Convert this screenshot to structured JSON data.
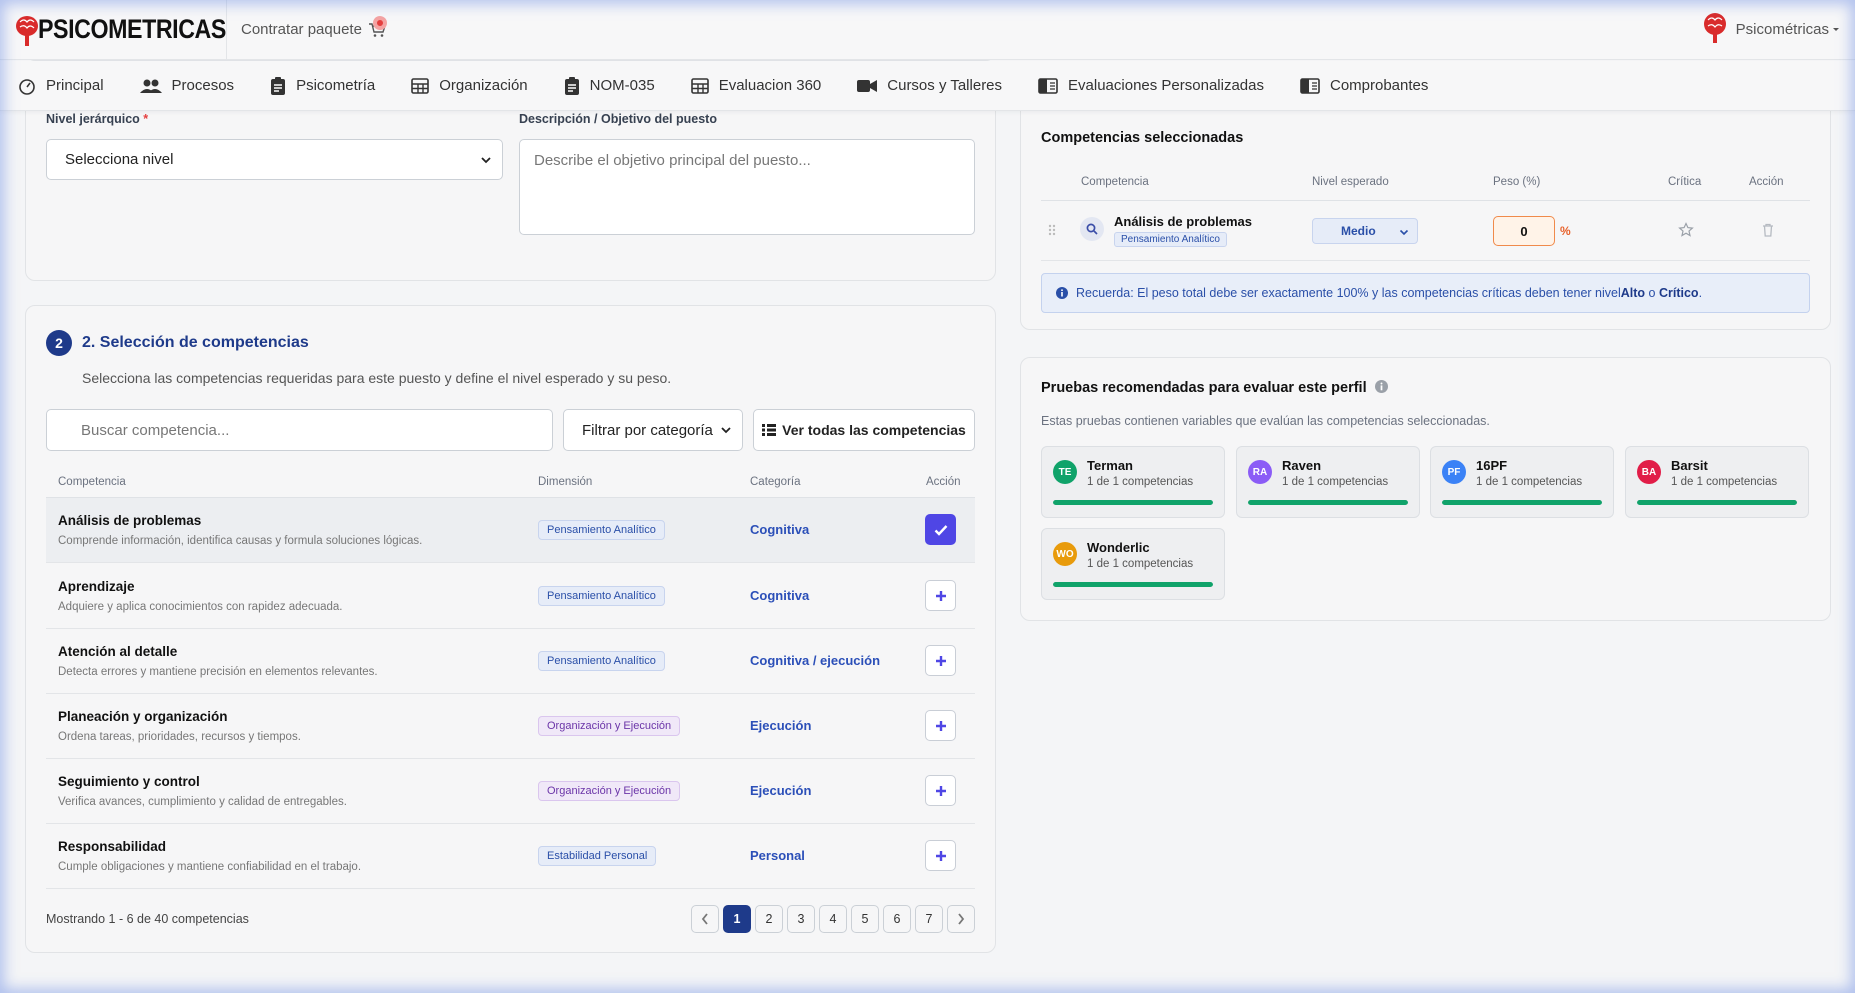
{
  "header": {
    "logo_text": "PSICOMETRICAS",
    "contratar": "Contratar paquete",
    "user": "Psicométricas"
  },
  "nav": [
    {
      "label": "Principal",
      "icon": "dashboard-icon"
    },
    {
      "label": "Procesos",
      "icon": "people-icon"
    },
    {
      "label": "Psicometría",
      "icon": "clipboard-icon"
    },
    {
      "label": "Organización",
      "icon": "table-icon"
    },
    {
      "label": "NOM-035",
      "icon": "clipboard-icon"
    },
    {
      "label": "Evaluacion 360",
      "icon": "table-icon"
    },
    {
      "label": "Cursos y Talleres",
      "icon": "video-icon"
    },
    {
      "label": "Evaluaciones Personalizadas",
      "icon": "book-icon"
    },
    {
      "label": "Comprobantes",
      "icon": "book-icon"
    }
  ],
  "form": {
    "nivel_label": "Nivel jerárquico",
    "required_mark": "*",
    "nivel_value": "Selecciona nivel",
    "descripcion_label": "Descripción / Objetivo del puesto",
    "descripcion_placeholder": "Describe el objetivo principal del puesto..."
  },
  "section2": {
    "number": "2",
    "title": "2. Selección de competencias",
    "subtitle": "Selecciona las competencias requeridas para este puesto y define el nivel esperado y su peso.",
    "search_placeholder": "Buscar competencia...",
    "filter_label": "Filtrar por categoría",
    "ver_todas": "Ver todas las competencias",
    "headers": [
      "Competencia",
      "Dimensión",
      "Categoría",
      "Acción"
    ],
    "rows": [
      {
        "name": "Análisis de problemas",
        "desc": "Comprende información, identifica causas y formula soluciones lógicas.",
        "dimension": "Pensamiento Analítico",
        "category": "Cognitiva",
        "selected": true
      },
      {
        "name": "Aprendizaje",
        "desc": "Adquiere y aplica conocimientos con rapidez adecuada.",
        "dimension": "Pensamiento Analítico",
        "category": "Cognitiva",
        "selected": false
      },
      {
        "name": "Atención al detalle",
        "desc": "Detecta errores y mantiene precisión en elementos relevantes.",
        "dimension": "Pensamiento Analítico",
        "category": "Cognitiva / ejecución",
        "selected": false
      },
      {
        "name": "Planeación y organización",
        "desc": "Ordena tareas, prioridades, recursos y tiempos.",
        "dimension": "Organización y Ejecución",
        "category": "Ejecución",
        "selected": false
      },
      {
        "name": "Seguimiento y control",
        "desc": "Verifica avances, cumplimiento y calidad de entregables.",
        "dimension": "Organización y Ejecución",
        "category": "Ejecución",
        "selected": false
      },
      {
        "name": "Responsabilidad",
        "desc": "Cumple obligaciones y mantiene confiabilidad en el trabajo.",
        "dimension": "Estabilidad Personal",
        "category": "Personal",
        "selected": false
      }
    ],
    "showing": "Mostrando 1 - 6 de 40 competencias",
    "pages": [
      "1",
      "2",
      "3",
      "4",
      "5",
      "6",
      "7"
    ],
    "active_page": "1"
  },
  "selected_panel": {
    "title": "Competencias seleccionadas",
    "headers": [
      "Competencia",
      "Nivel esperado",
      "Peso (%)",
      "Crítica",
      "Acción"
    ],
    "item": {
      "name": "Análisis de problemas",
      "dimension": "Pensamiento Analítico",
      "level": "Medio",
      "weight": "0",
      "unit": "%"
    },
    "alert_pre": "Recuerda: El peso total debe ser exactamente 100% y las competencias críticas deben tener nivel ",
    "alert_alto": "Alto",
    "alert_mid": " o ",
    "alert_critico": "Crítico",
    "alert_end": "."
  },
  "tests_panel": {
    "title": "Pruebas recomendadas para evaluar este perfil",
    "subtitle": "Estas pruebas contienen variables que evalúan las competencias seleccionadas.",
    "tests": [
      {
        "abbr": "TE",
        "name": "Terman",
        "count": "1 de 1 competencias",
        "color": "#10a36a",
        "progress": 1.0
      },
      {
        "abbr": "RA",
        "name": "Raven",
        "count": "1 de 1 competencias",
        "color": "#8b5cf6",
        "progress": 1.0
      },
      {
        "abbr": "PF",
        "name": "16PF",
        "count": "1 de 1 competencias",
        "color": "#3b82f6",
        "progress": 1.0
      },
      {
        "abbr": "BA",
        "name": "Barsit",
        "count": "1 de 1 competencias",
        "color": "#e11d48",
        "progress": 1.0
      },
      {
        "abbr": "WO",
        "name": "Wonderlic",
        "count": "1 de 1 competencias",
        "color": "#e89b0c",
        "progress": 1.0
      }
    ]
  }
}
